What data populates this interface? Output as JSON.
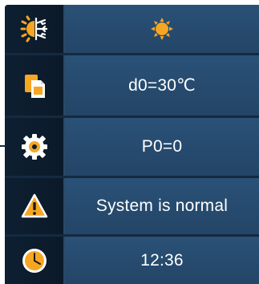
{
  "rows": [
    {
      "key": "mode",
      "icon": "heat-cool-mode-icon",
      "value_icon": "sun-icon"
    },
    {
      "key": "setpoint",
      "icon": "documents-icon",
      "value": "d0=30℃"
    },
    {
      "key": "parameter",
      "icon": "gear-icon",
      "value": "P0=0"
    },
    {
      "key": "status",
      "icon": "warning-icon",
      "value": "System is normal"
    },
    {
      "key": "clock",
      "icon": "clock-icon",
      "value": "12:36"
    }
  ],
  "colors": {
    "accent": "#f6a623",
    "text": "#ffffff",
    "value_bg": "#264b6f",
    "icon_bg": "#0d1f31"
  }
}
